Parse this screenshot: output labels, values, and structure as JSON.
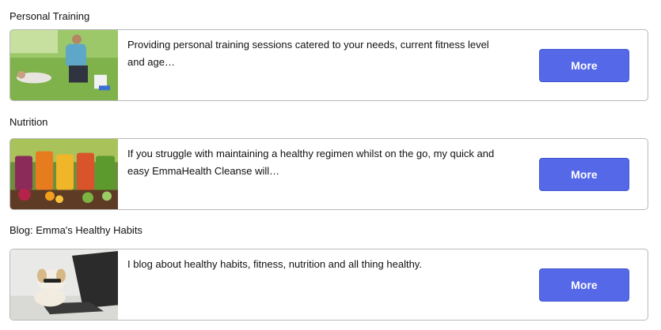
{
  "services": [
    {
      "title": "Personal Training",
      "description": "Providing personal training sessions catered to your needs, current fitness level and age…",
      "image": "personal-training-photo",
      "button_label": "More"
    },
    {
      "title": "Nutrition",
      "description": "If you struggle with maintaining a healthy regimen whilst on the go, my quick and easy EmmaHealth Cleanse will…",
      "image": "juices-and-fruit-photo",
      "button_label": "More"
    },
    {
      "title": "Blog: Emma's Healthy Habits",
      "description": "I blog about healthy habits, fitness, nutrition and all thing healthy.",
      "image": "dog-with-laptop-photo",
      "button_label": "More"
    }
  ],
  "colors": {
    "button_bg": "#5468e8",
    "card_border": "#b9b9b9"
  }
}
